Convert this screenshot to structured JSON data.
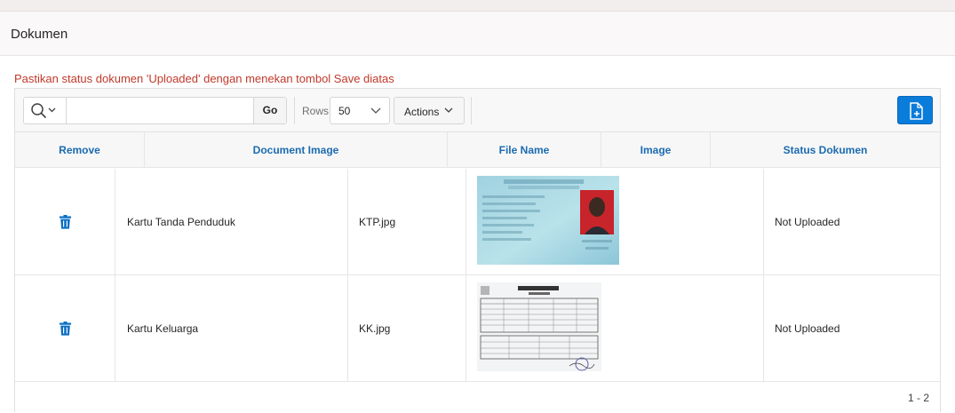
{
  "region": {
    "title": "Dokumen"
  },
  "note": "Pastikan status dokumen 'Uploaded' dengan menekan tombol Save diatas",
  "toolbar": {
    "search_value": "",
    "go_label": "Go",
    "rows_label": "Rows",
    "rows_value": "50",
    "actions_label": "Actions"
  },
  "columns": [
    "Remove",
    "Document Image",
    "File Name",
    "Image",
    "Status Dokumen"
  ],
  "rows": [
    {
      "document": "Kartu Tanda Penduduk",
      "file_name": "KTP.jpg",
      "image": "ktp-card-photo",
      "status": "Not Uploaded"
    },
    {
      "document": "Kartu Keluarga",
      "file_name": "KK.jpg",
      "image": "kartu-keluarga-scan",
      "status": "Not Uploaded"
    }
  ],
  "pagination": "1 - 2",
  "colors": {
    "accent": "#0a7ddb",
    "header_text": "#1b6bb0",
    "note": "#c0392b"
  }
}
